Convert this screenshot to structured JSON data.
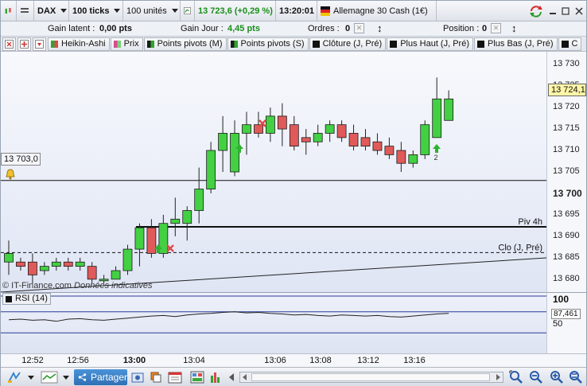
{
  "toolbar": {
    "instrument": "DAX",
    "period": "100 ticks",
    "units": "100 unités",
    "price_change": "13 723,6 (+0,29 %)",
    "time": "13:20:01",
    "market": "Allemagne 30 Cash (1€)"
  },
  "account": {
    "gain_latent_label": "Gain latent :",
    "gain_latent_value": "0,00 pts",
    "gain_jour_label": "Gain Jour :",
    "gain_jour_value": "4,45 pts",
    "ordres_label": "Ordres :",
    "ordres_value": "0",
    "position_label": "Position :",
    "position_value": "0"
  },
  "indicators": [
    {
      "label": "Heikin-Ashi",
      "color": "#27a827"
    },
    {
      "label": "Prix",
      "color": "#d84b8c"
    },
    {
      "label": "Points pivots (M)",
      "color": "#1b1b1b"
    },
    {
      "label": "Points pivots (S)",
      "color": "#1b1b1b"
    },
    {
      "label": "Clôture (J, Pré)",
      "color": "#111111"
    },
    {
      "label": "Plus Haut (J, Pré)",
      "color": "#111111"
    },
    {
      "label": "Plus Bas (J, Pré)",
      "color": "#111111"
    },
    {
      "label": "C",
      "color": "#111111"
    }
  ],
  "chart": {
    "price_ticks": [
      "13 730",
      "13 725",
      "13 720",
      "13 715",
      "13 710",
      "13 705",
      "13 700",
      "13 695",
      "13 690",
      "13 685",
      "13 680"
    ],
    "current_price": "13 724,1",
    "level_box": "13 703,0",
    "pivot_label": "Piv 4h",
    "close_label": "Clo (J, Pré)",
    "watermark": "© IT-Finance.com",
    "watermark_note": "Données indicatives",
    "signal_count": "2"
  },
  "chart_data": {
    "type": "candlestick",
    "ylim": [
      13677,
      13733
    ],
    "candles": [
      {
        "o": 13684,
        "c": 13686,
        "h": 13689,
        "l": 13681
      },
      {
        "o": 13684,
        "c": 13683,
        "h": 13685,
        "l": 13682
      },
      {
        "o": 13684,
        "c": 13681,
        "h": 13686,
        "l": 13679
      },
      {
        "o": 13682,
        "c": 13683,
        "h": 13684,
        "l": 13681
      },
      {
        "o": 13683,
        "c": 13684,
        "h": 13685,
        "l": 13682
      },
      {
        "o": 13684,
        "c": 13683,
        "h": 13685,
        "l": 13682
      },
      {
        "o": 13683,
        "c": 13684,
        "h": 13685,
        "l": 13682
      },
      {
        "o": 13683,
        "c": 13680,
        "h": 13684,
        "l": 13679
      },
      {
        "o": 13680,
        "c": 13680,
        "h": 13681,
        "l": 13679
      },
      {
        "o": 13680,
        "c": 13682,
        "h": 13683,
        "l": 13680
      },
      {
        "o": 13682,
        "c": 13687,
        "h": 13688,
        "l": 13681
      },
      {
        "o": 13687,
        "c": 13692,
        "h": 13693,
        "l": 13683
      },
      {
        "o": 13692,
        "c": 13686,
        "h": 13694,
        "l": 13685
      },
      {
        "o": 13686,
        "c": 13693,
        "h": 13695,
        "l": 13685
      },
      {
        "o": 13693,
        "c": 13694,
        "h": 13699,
        "l": 13690
      },
      {
        "o": 13693,
        "c": 13696,
        "h": 13697,
        "l": 13689
      },
      {
        "o": 13696,
        "c": 13701,
        "h": 13706,
        "l": 13693
      },
      {
        "o": 13701,
        "c": 13710,
        "h": 13712,
        "l": 13700
      },
      {
        "o": 13710,
        "c": 13714,
        "h": 13718,
        "l": 13705
      },
      {
        "o": 13705,
        "c": 13714,
        "h": 13717,
        "l": 13704
      },
      {
        "o": 13714,
        "c": 13716,
        "h": 13719,
        "l": 13709
      },
      {
        "o": 13716,
        "c": 13714,
        "h": 13719,
        "l": 13713
      },
      {
        "o": 13714,
        "c": 13718,
        "h": 13720,
        "l": 13712
      },
      {
        "o": 13718,
        "c": 13715,
        "h": 13721,
        "l": 13711
      },
      {
        "o": 13716,
        "c": 13711,
        "h": 13718,
        "l": 13710
      },
      {
        "o": 13713,
        "c": 13712,
        "h": 13715,
        "l": 13709
      },
      {
        "o": 13712,
        "c": 13714,
        "h": 13716,
        "l": 13711
      },
      {
        "o": 13714,
        "c": 13716,
        "h": 13717,
        "l": 13712
      },
      {
        "o": 13716,
        "c": 13713,
        "h": 13717,
        "l": 13712
      },
      {
        "o": 13714,
        "c": 13711,
        "h": 13716,
        "l": 13710
      },
      {
        "o": 13713,
        "c": 13711,
        "h": 13715,
        "l": 13710
      },
      {
        "o": 13712,
        "c": 13710,
        "h": 13714,
        "l": 13709
      },
      {
        "o": 13711,
        "c": 13709,
        "h": 13713,
        "l": 13708
      },
      {
        "o": 13710,
        "c": 13707,
        "h": 13712,
        "l": 13705
      },
      {
        "o": 13707,
        "c": 13709,
        "h": 13710,
        "l": 13706
      },
      {
        "o": 13709,
        "c": 13716,
        "h": 13717,
        "l": 13708
      },
      {
        "o": 13713,
        "c": 13722,
        "h": 13727,
        "l": 13713
      },
      {
        "o": 13717,
        "c": 13722,
        "h": 13724,
        "l": 13717
      }
    ],
    "hlines": [
      {
        "label": "Piv 4h",
        "value": 13692.2,
        "style": "solid"
      },
      {
        "label": "Clo (J, Pré)",
        "value": 13686.2,
        "style": "dashed"
      },
      {
        "label": "13 703,0",
        "value": 13703.0,
        "style": "solid"
      }
    ],
    "rsi_values": [
      55,
      56,
      54,
      55,
      52,
      56,
      57,
      55,
      54,
      56,
      58,
      60,
      62,
      63,
      61,
      64,
      66,
      67,
      69,
      70,
      68,
      69,
      67,
      66,
      64,
      65,
      63,
      62,
      64,
      63,
      62,
      63,
      61,
      60,
      62,
      64,
      66,
      67
    ]
  },
  "rsi": {
    "label": "RSI (14)",
    "top_tick": "100",
    "value": "87,461",
    "mid_tick": "50"
  },
  "time_axis": [
    "12:52",
    "12:56",
    "13:00",
    "13:04",
    "13:06",
    "13:08",
    "13:12",
    "13:16"
  ],
  "bottom": {
    "share_label": "Partager"
  }
}
